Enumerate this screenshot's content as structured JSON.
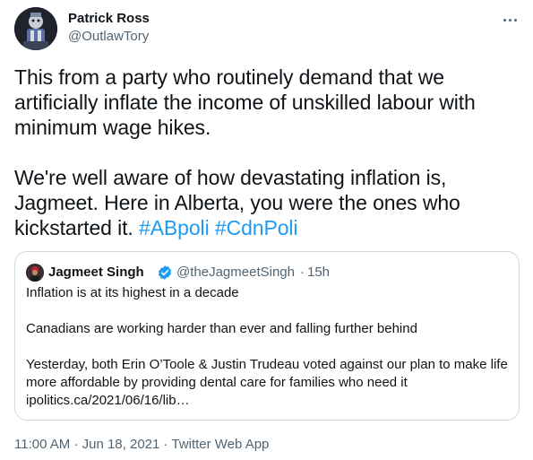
{
  "author": {
    "display_name": "Patrick Ross",
    "handle": "@OutlawTory"
  },
  "tweet": {
    "paragraph_1": "This from a party who routinely demand that we artificially inflate the income of unskilled labour with minimum wage hikes.",
    "paragraph_2_text": "We're well aware of how devastating inflation is, Jagmeet. Here in Alberta, you were the ones who kickstarted it. ",
    "hashtags": [
      "#ABpoli",
      "#CdnPoli"
    ]
  },
  "quoted_tweet": {
    "display_name": "Jagmeet Singh",
    "verified": true,
    "handle": "@theJagmeetSingh",
    "separator": "·",
    "time": "15h",
    "lines": [
      "Inflation is at its highest in a decade",
      "Canadians are working harder than ever and falling further behind",
      "Yesterday, both Erin O’Toole & Justin Trudeau voted against our plan to make life more affordable by providing dental care for families who need it ipolitics.ca/2021/06/16/lib…"
    ]
  },
  "meta": {
    "time": "11:00 AM",
    "separator": "·",
    "date": "Jun 18, 2021",
    "source": "Twitter Web App"
  },
  "colors": {
    "link": "#1d9bf0",
    "secondary_text": "#536471",
    "border": "#cfd9de"
  },
  "icons": {
    "more": "more-icon",
    "verified": "verified-badge-icon"
  }
}
